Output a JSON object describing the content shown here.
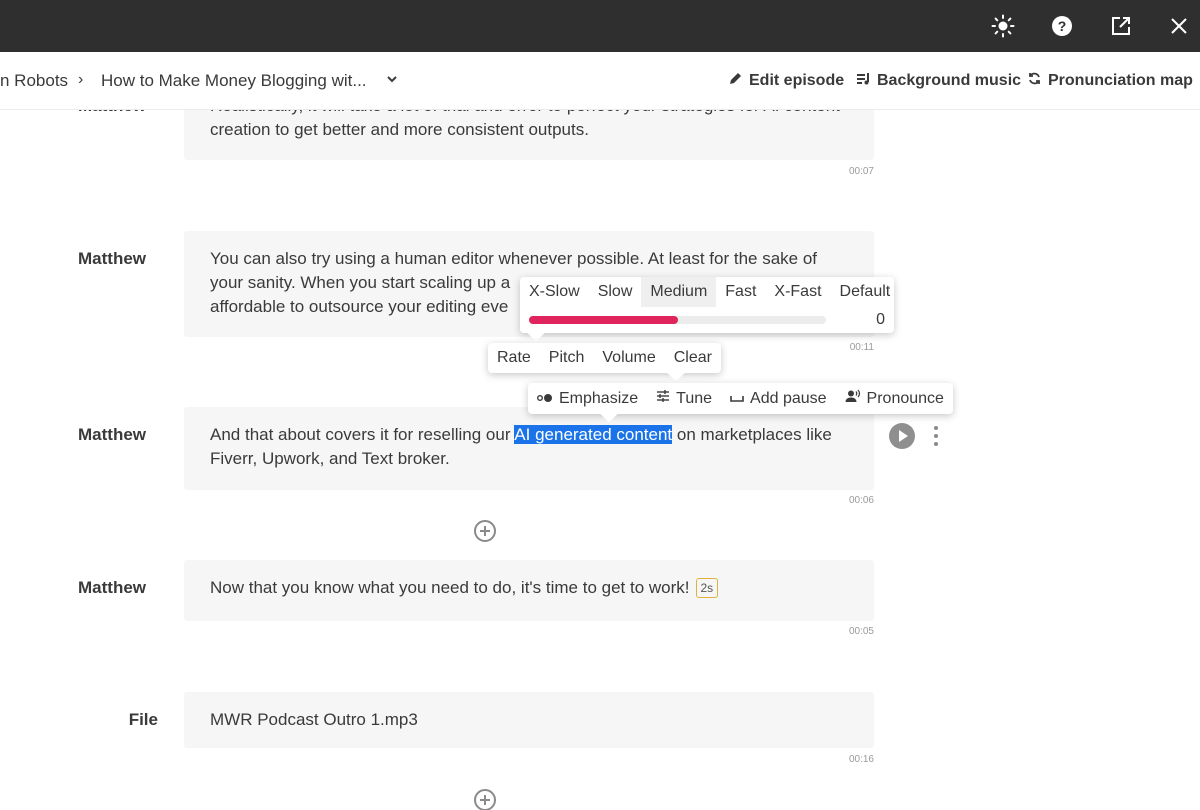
{
  "topbar": {
    "icons": [
      "brightness-icon",
      "help-icon",
      "open-external-icon",
      "close-icon"
    ]
  },
  "breadcrumb": {
    "parent": "n Robots",
    "separator": "›",
    "current": "How to Make Money Blogging wit..."
  },
  "actions": {
    "edit_episode": "Edit episode",
    "background_music": "Background music",
    "pronunciation_map": "Pronunciation map"
  },
  "blocks": [
    {
      "speaker": "Matthew",
      "text": "Realistically, it will take a lot of trial and error to perfect your strategies for AI content creation to get better and more consistent outputs.",
      "time": "00:07"
    },
    {
      "speaker": "Matthew",
      "text": "You can also try using a human editor whenever possible. At least for the sake of your sanity. When you start scaling up a",
      "text_end": "affordable to outsource your editing eve",
      "time": "00:11"
    },
    {
      "speaker": "Matthew",
      "text_before": "And that about covers it for reselling our ",
      "highlight": "AI generated content",
      "text_after": " on marketplaces like Fiverr, Upwork, and Text broker.",
      "time": "00:06"
    },
    {
      "speaker": "Matthew",
      "text": "Now that you know what you need to do, it's time to get to work!",
      "pause_badge": "2s",
      "time": "00:05"
    },
    {
      "speaker": "File",
      "text": "MWR Podcast Outro 1.mp3",
      "time": "00:16"
    }
  ],
  "speed_popup": {
    "options": [
      "X-Slow",
      "Slow",
      "Medium",
      "Fast",
      "X-Fast",
      "Default"
    ],
    "selected": "Medium",
    "slider_value_fraction": 0.5,
    "value": "0"
  },
  "tabs_popup": {
    "items": [
      "Rate",
      "Pitch",
      "Volume",
      "Clear"
    ]
  },
  "toolbar": {
    "emphasize": "Emphasize",
    "tune": "Tune",
    "add_pause": "Add pause",
    "pronounce": "Pronounce"
  },
  "colors": {
    "topbar": "#2f2f2f",
    "accent": "#e0245e",
    "highlight": "#1a73e8",
    "block_bg": "#f6f6f6"
  }
}
